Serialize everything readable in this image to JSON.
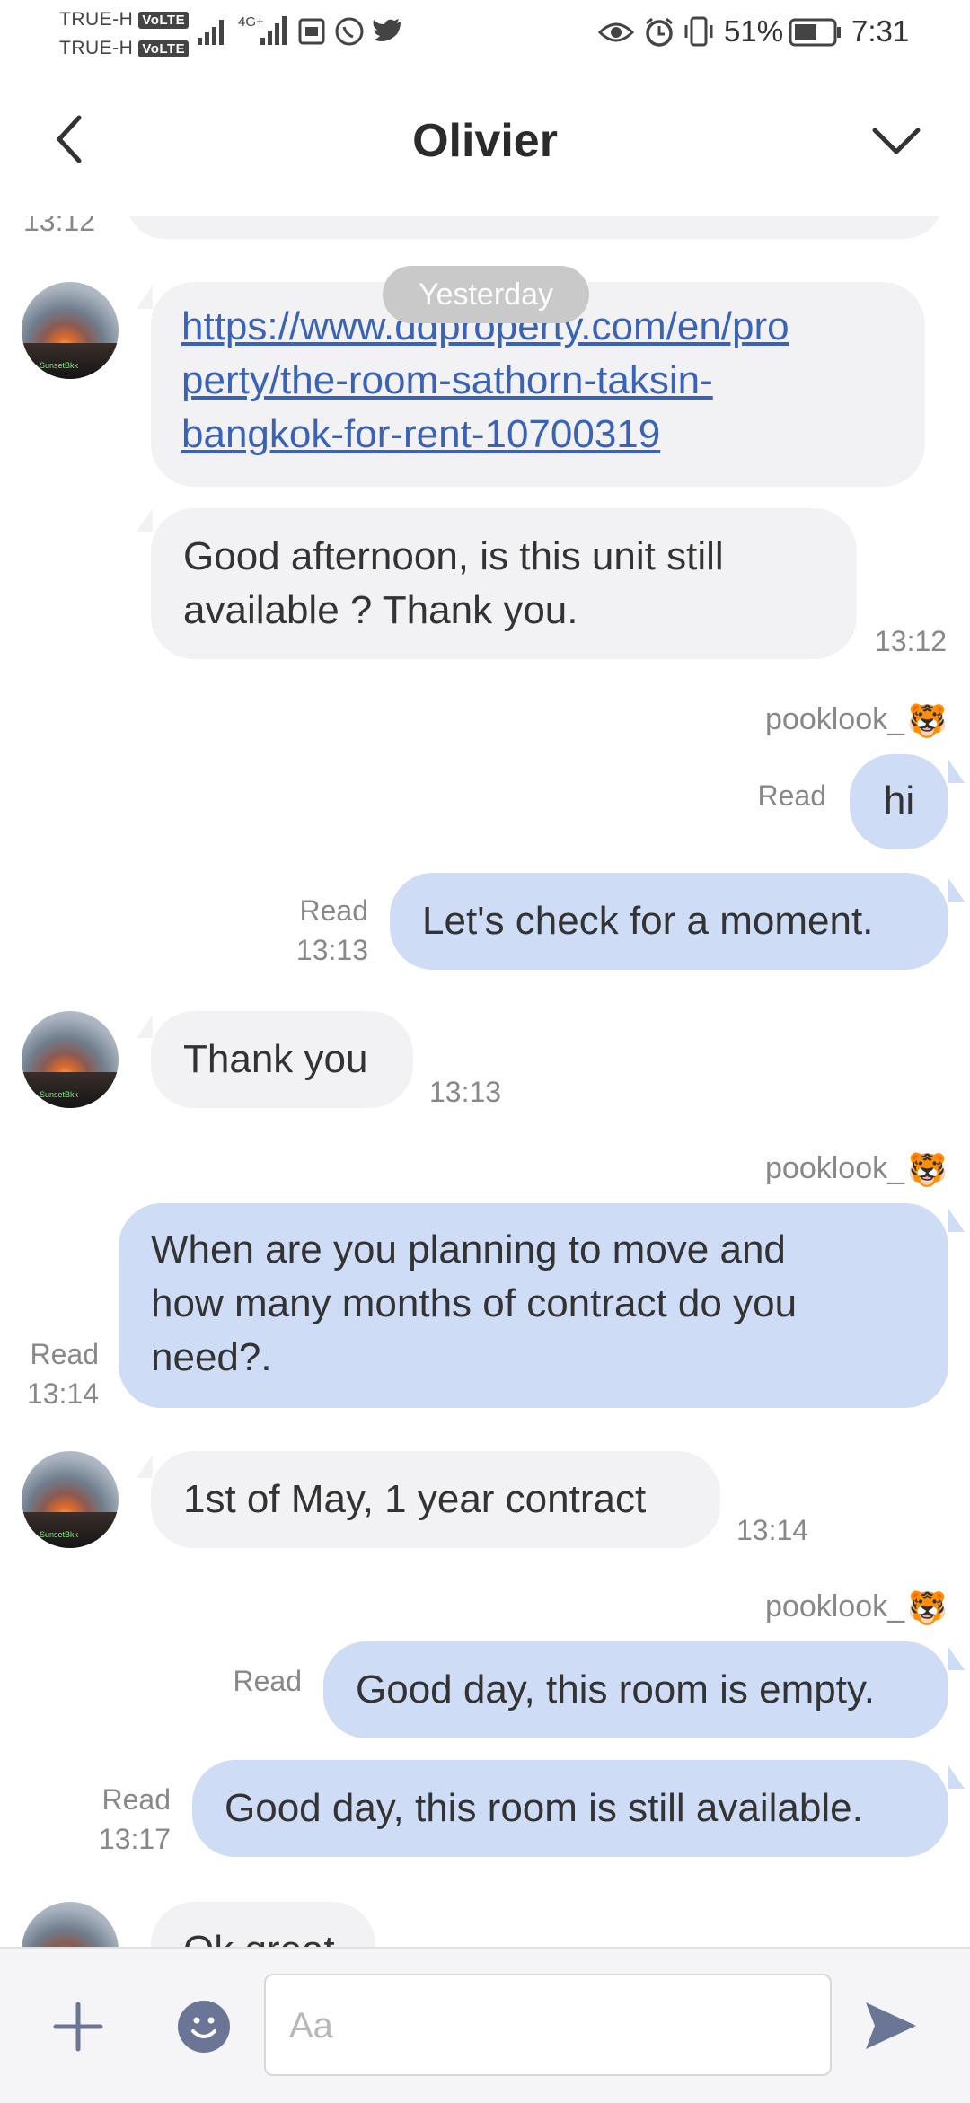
{
  "status_bar": {
    "carrier_1": "TRUE-H",
    "carrier_2": "TRUE-H",
    "volte": "VoLTE",
    "network": "4G+",
    "battery": "51%",
    "time": "7:31"
  },
  "header": {
    "title": "Olivier",
    "back_icon": "chevron-left-icon",
    "menu_icon": "chevron-down-icon"
  },
  "chat": {
    "top_time": "13:12",
    "date_pill": "Yesterday",
    "messages": [
      {
        "from": "Olivier",
        "text_link": "https://www.ddproperty.com/en/property/the-room-sathorn-taksin-bangkok-for-rent-10700319",
        "line1": "https://www.ddproperty.com/en/pro",
        "line2": "perty/the-room-sathorn-taksin-",
        "line3": "bangkok-for-rent-10700319"
      },
      {
        "from": "Olivier",
        "line1": "Good afternoon, is this unit still",
        "line2": "available ? Thank you.",
        "time": "13:12"
      },
      {
        "from": "pooklook_",
        "sender": "pooklook_",
        "text": "hi",
        "status": "Read"
      },
      {
        "from": "pooklook_",
        "text": "Let's check for a moment.",
        "status": "Read",
        "time": "13:13"
      },
      {
        "from": "Olivier",
        "text": "Thank you",
        "time": "13:13"
      },
      {
        "from": "pooklook_",
        "sender": "pooklook_",
        "line1": "When are you planning to move and",
        "line2": "how many months of contract do you",
        "line3": "need?.",
        "status": "Read",
        "time": "13:14"
      },
      {
        "from": "Olivier",
        "text": "1st of May, 1 year contract",
        "time": "13:14"
      },
      {
        "from": "pooklook_",
        "sender": "pooklook_",
        "text": "Good day, this room is empty.",
        "status": "Read"
      },
      {
        "from": "pooklook_",
        "text": "Good day, this room is still available.",
        "status": "Read",
        "time": "13:17"
      },
      {
        "from": "Olivier",
        "text": "Ok great"
      }
    ]
  },
  "input": {
    "placeholder": "Aa",
    "add_icon": "plus-icon",
    "emoji_icon": "emoji-icon",
    "send_icon": "send-icon"
  },
  "colors": {
    "incoming_bubble": "#f2f2f4",
    "outgoing_bubble": "#cfdcf5",
    "link": "#3a63b8",
    "icon": "#6b7596"
  }
}
